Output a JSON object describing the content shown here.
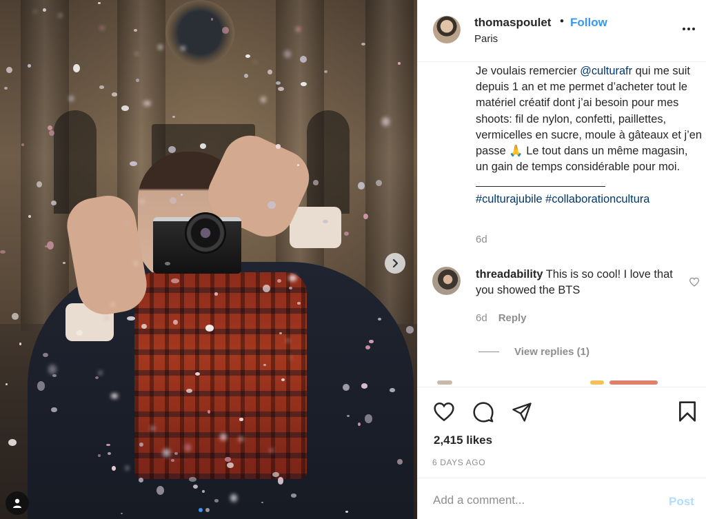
{
  "post": {
    "author": {
      "username": "thomaspoulet",
      "separator": "•",
      "follow_label": "Follow",
      "location": "Paris"
    },
    "caption": {
      "part1": "Je voulais remercier ",
      "mention": "@culturafr",
      "part2": " qui me suit depuis 1 an et me permet d’acheter tout le matériel créatif dont j’ai besoin pour mes shoots: fil de nylon, confetti, paillettes, vermicelles en sucre, moule à gâteaux et j’en passe ",
      "emoji": "🙏",
      "part3": " Le tout dans un même magasin, un gain de temps considérable pour moi.",
      "hashtag1": "#culturajubile",
      "hashtag2": "#collaborationcultura",
      "time": "6d"
    },
    "comments": [
      {
        "username": "threadability",
        "text": "This is so cool! I love that you showed the BTS",
        "time": "6d",
        "reply_label": "Reply",
        "view_replies_label": "View replies (1)"
      }
    ],
    "likes": "2,415 likes",
    "posted": "6 DAYS AGO",
    "add_comment": {
      "placeholder": "Add a comment...",
      "post_label": "Post"
    },
    "carousel": {
      "slide_count": 2,
      "active_slide": 1
    }
  },
  "icons": {
    "more": "more-options-icon",
    "like": "heart-icon",
    "comment": "comment-icon",
    "share": "share-icon",
    "save": "bookmark-icon",
    "next": "chevron-right-icon",
    "tagged": "user-tag-icon"
  },
  "colors": {
    "follow": "#3897f0",
    "link": "#00376b",
    "muted": "#8e8e8e",
    "post_disabled": "#b3dbff",
    "active_dot": "#3b95f0"
  }
}
